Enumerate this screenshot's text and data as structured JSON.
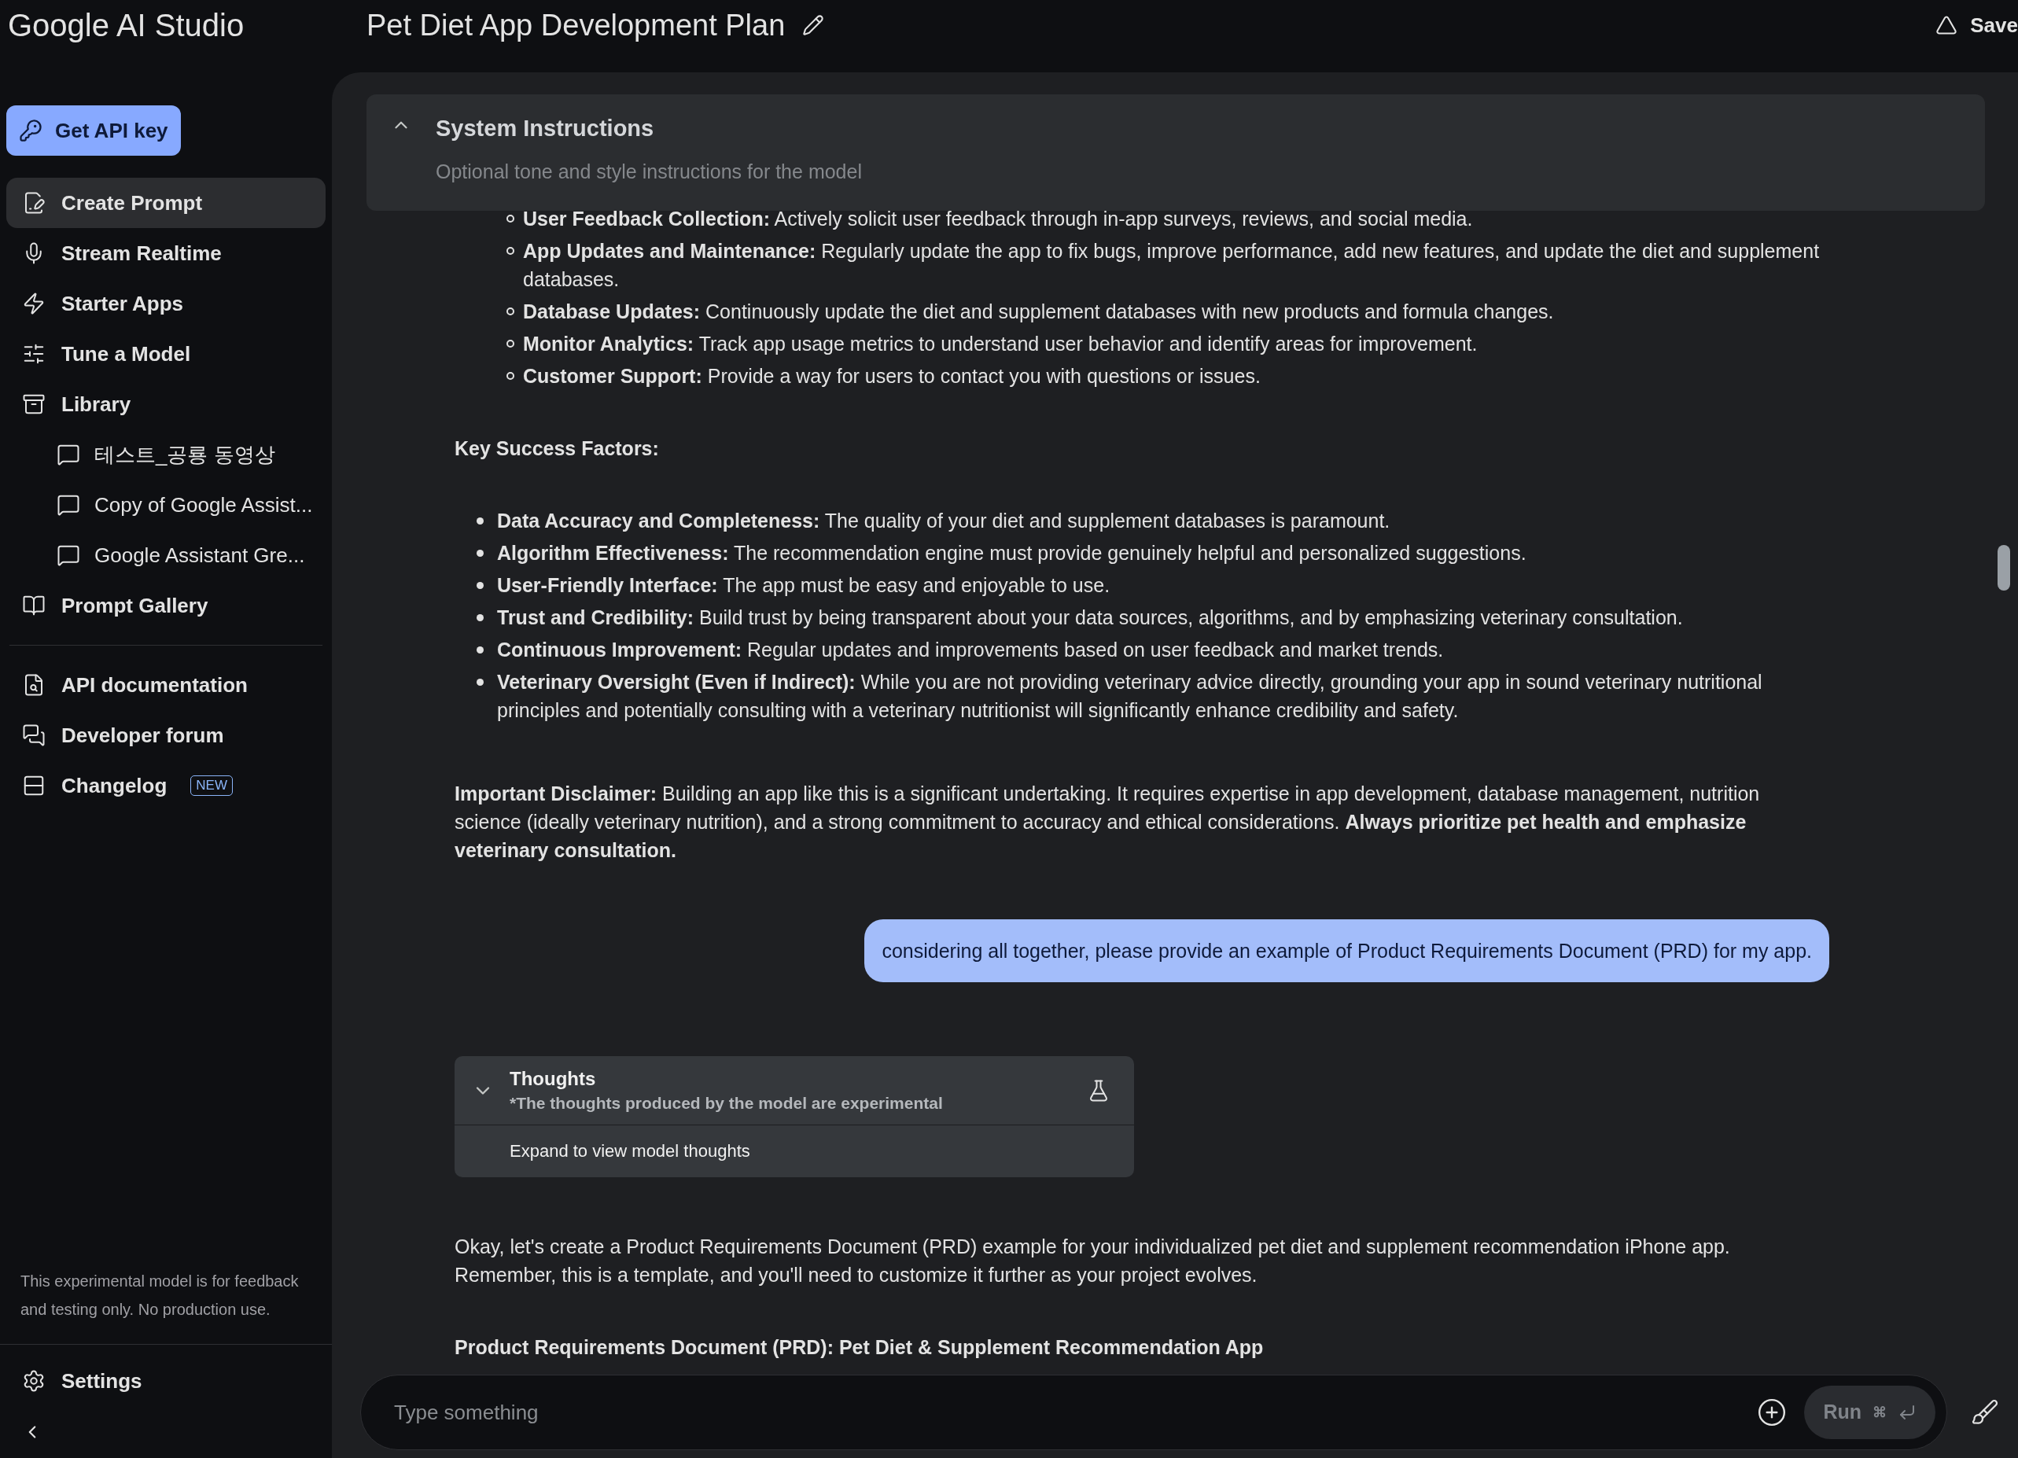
{
  "app_title": "Google AI Studio",
  "api_key_button": "Get API key",
  "sidebar": {
    "items": [
      {
        "kind": "nav",
        "label": "Create Prompt",
        "selected": true
      },
      {
        "kind": "nav",
        "label": "Stream Realtime",
        "selected": false
      },
      {
        "kind": "nav",
        "label": "Starter Apps",
        "selected": false
      },
      {
        "kind": "nav",
        "label": "Tune a Model",
        "selected": false
      },
      {
        "kind": "nav",
        "label": "Library",
        "selected": false,
        "children": [
          {
            "label": "테스트_공룡 동영상",
            "selected": false
          },
          {
            "label": "Copy of Google Assist...",
            "selected": false
          },
          {
            "label": "Google Assistant Gre...",
            "selected": false
          }
        ]
      },
      {
        "kind": "nav",
        "label": "Prompt Gallery",
        "selected": false
      },
      {
        "kind": "divider"
      },
      {
        "kind": "nav",
        "label": "API documentation",
        "selected": false
      },
      {
        "kind": "nav",
        "label": "Developer forum",
        "selected": false
      },
      {
        "kind": "nav",
        "label": "Changelog",
        "selected": false,
        "badge": "NEW"
      }
    ],
    "note": "This experimental model is for feedback and testing only. No production use.",
    "settings": "Settings"
  },
  "header": {
    "title": "Pet Diet App Development Plan",
    "save": "Save"
  },
  "system_instructions": {
    "title": "System Instructions",
    "placeholder": "Optional tone and style instructions for the model",
    "expanded": true
  },
  "blocks": [
    {
      "kind": "sub_list",
      "items": [
        "**User Feedback Collection:** Actively solicit user feedback through in-app surveys, reviews, and social media.",
        "**App Updates and Maintenance:** Regularly update the app to fix bugs, improve performance, add new features, and update the diet and supplement databases.",
        "**Database Updates:** Continuously update the diet and supplement databases with new products and formula changes.",
        "**Monitor Analytics:** Track app usage metrics to understand user behavior and identify areas for improvement.",
        "**Customer Support:** Provide a way for users to contact you with questions or issues."
      ]
    },
    {
      "kind": "heading",
      "text": "Key Success Factors:"
    },
    {
      "kind": "bullet_list",
      "items": [
        "**Data Accuracy and Completeness:** The quality of your diet and supplement databases is paramount.",
        "**Algorithm Effectiveness:** The recommendation engine must provide genuinely helpful and personalized suggestions.",
        "**User-Friendly Interface:** The app must be easy and enjoyable to use.",
        "**Trust and Credibility:** Build trust by being transparent about your data sources, algorithms, and by emphasizing veterinary consultation.",
        "**Continuous Improvement:** Regular updates and improvements based on user feedback and market trends.",
        "**Veterinary Oversight (Even if Indirect):** While you are not providing veterinary advice directly, grounding your app in sound veterinary nutritional principles and potentially consulting with a veterinary nutritionist will significantly enhance credibility and safety."
      ]
    },
    {
      "kind": "paragraph",
      "text": "**Important Disclaimer:** Building an app like this is a significant undertaking. It requires expertise in app development, database management, nutrition science (ideally veterinary nutrition), and a strong commitment to accuracy and ethical considerations. **Always prioritize pet health and emphasize veterinary consultation.**"
    },
    {
      "kind": "user_message",
      "text": "considering all together, please provide an example of Product Requirements Document (PRD) for my app."
    },
    {
      "kind": "thoughts",
      "title": "Thoughts",
      "subtitle": "*The thoughts produced by the model are experimental",
      "body": "Expand to view model thoughts",
      "expanded": false
    },
    {
      "kind": "paragraph",
      "text": "Okay, let's create a Product Requirements Document (PRD) example for your individualized pet diet and supplement recommendation iPhone app. Remember, this is a template, and you'll need to customize it further as your project evolves."
    },
    {
      "kind": "heading",
      "text": "Product Requirements Document (PRD): Pet Diet & Supplement Recommendation App"
    }
  ],
  "input": {
    "placeholder": "Type something",
    "run": "Run",
    "shortcut": "⌘",
    "run_disabled": true
  }
}
